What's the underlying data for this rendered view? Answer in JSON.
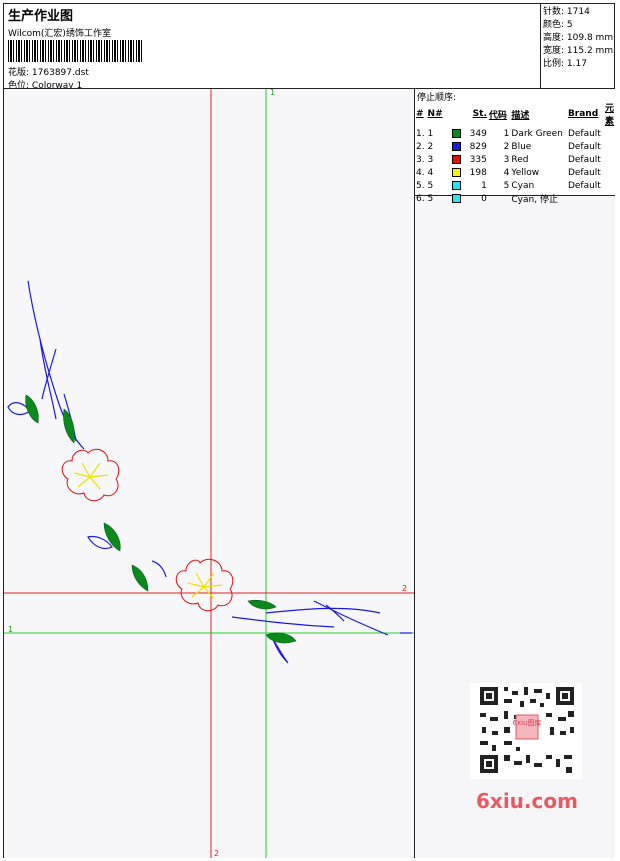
{
  "header": {
    "title": "生产作业图",
    "company": "Wilcom(汇宏)绣饰工作室",
    "design_label": "花版:",
    "design_value": "1763897.dst",
    "colorway_label": "色位:",
    "colorway_value": "Colorway 1"
  },
  "info": {
    "stitches_label": "针数:",
    "stitches": "1714",
    "colors_label": "颜色:",
    "colors": "5",
    "height_label": "高度:",
    "height": "109.8 mm",
    "width_label": "宽度:",
    "width": "115.2 mm",
    "scale_label": "比例:",
    "scale": "1.17"
  },
  "stop_sequence": {
    "title": "停止顺序:",
    "columns": [
      "#",
      "N#",
      "St.",
      "代码",
      "描述",
      "Brand",
      "元素"
    ],
    "rows": [
      {
        "idx": "1.",
        "n": "1",
        "color": "#0a8a1a",
        "st": "349",
        "code": "1",
        "desc": "Dark Green",
        "brand": "Default"
      },
      {
        "idx": "2.",
        "n": "2",
        "color": "#1a1ae0",
        "st": "829",
        "code": "2",
        "desc": "Blue",
        "brand": "Default"
      },
      {
        "idx": "3.",
        "n": "3",
        "color": "#e01010",
        "st": "335",
        "code": "3",
        "desc": "Red",
        "brand": "Default"
      },
      {
        "idx": "4.",
        "n": "4",
        "color": "#f7f700",
        "st": "198",
        "code": "4",
        "desc": "Yellow",
        "brand": "Default"
      },
      {
        "idx": "5.",
        "n": "5",
        "color": "#20e8f0",
        "st": "1",
        "code": "5",
        "desc": "Cyan",
        "brand": "Default"
      },
      {
        "idx": "6.",
        "n": "5",
        "color": "#20e8f0",
        "st": "0",
        "code": "",
        "desc": "Cyan, 停止",
        "brand": ""
      }
    ]
  },
  "guides": {
    "vertical_1": "1",
    "vertical_2": "2",
    "horizontal_1": "1",
    "horizontal_2": "2"
  },
  "watermark": "6xiu.com",
  "qr_stamp": "6xiu图库"
}
